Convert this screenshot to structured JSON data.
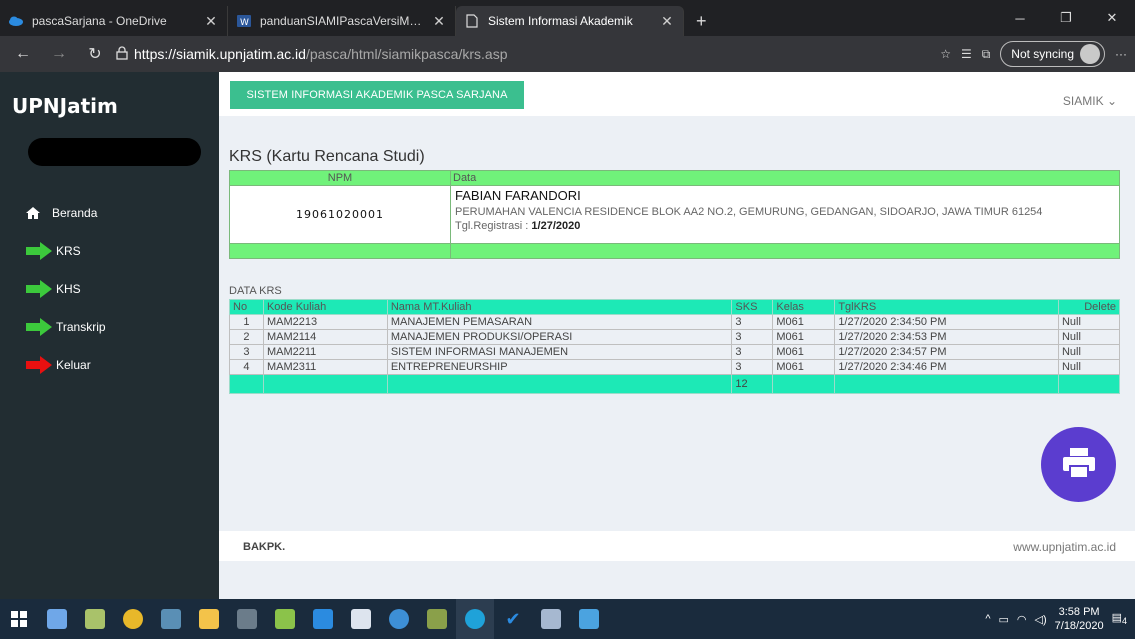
{
  "browser": {
    "tabs": [
      {
        "title": "pascaSarjana - OneDrive",
        "icon": "onedrive-icon",
        "active": false
      },
      {
        "title": "panduanSIAMIPascaVersiMahasi",
        "icon": "word-doc-icon",
        "active": false
      },
      {
        "title": "Sistem Informasi Akademik",
        "icon": "page-icon",
        "active": true
      }
    ],
    "url_host": "https://siamik.upnjatim.ac.id",
    "url_path": "/pasca/html/siamikpasca/krs.asp",
    "sync_label": "Not syncing"
  },
  "sidebar": {
    "brand": "UPNJatim",
    "items": [
      {
        "label": "Beranda",
        "icon": "home-icon"
      },
      {
        "label": "KRS",
        "icon": "green-arrow-icon"
      },
      {
        "label": "KHS",
        "icon": "green-arrow-icon"
      },
      {
        "label": "Transkrip",
        "icon": "green-arrow-icon"
      },
      {
        "label": "Keluar",
        "icon": "red-arrow-icon"
      }
    ]
  },
  "header": {
    "system_button": "SISTEM INFORMASI AKADEMIK PASCA SARJANA",
    "user_menu": "SIAMIK"
  },
  "krs": {
    "title": "KRS (Kartu Rencana Studi)",
    "npm_label": "NPM",
    "data_label": "Data",
    "npm": "19061020001",
    "nama": "FABIAN FARANDORI",
    "alamat": "PERUMAHAN VALENCIA RESIDENCE BLOK AA2 NO.2, GEMURUNG, GEDANGAN, SIDOARJO, JAWA TIMUR 61254",
    "tgl_label": "Tgl.Registrasi : ",
    "tgl_value": "1/27/2020"
  },
  "data_krs": {
    "label": "DATA KRS",
    "headers": [
      "No",
      "Kode Kuliah",
      "Nama MT.Kuliah",
      "SKS",
      "Kelas",
      "TglKRS",
      "Delete"
    ],
    "rows": [
      [
        "1",
        "MAM2213",
        "MANAJEMEN PEMASARAN",
        "3",
        "M061",
        "1/27/2020 2:34:50 PM",
        "Null"
      ],
      [
        "2",
        "MAM2114",
        "MANAJEMEN PRODUKSI/OPERASI",
        "3",
        "M061",
        "1/27/2020 2:34:53 PM",
        "Null"
      ],
      [
        "3",
        "MAM2211",
        "SISTEM INFORMASI MANAJEMEN",
        "3",
        "M061",
        "1/27/2020 2:34:57 PM",
        "Null"
      ],
      [
        "4",
        "MAM2311",
        "ENTREPRENEURSHIP",
        "3",
        "M061",
        "1/27/2020 2:34:46 PM",
        "Null"
      ]
    ],
    "total_sks": "12"
  },
  "footer": {
    "left": "BAKPK.",
    "right": "www.upnjatim.ac.id"
  },
  "taskbar": {
    "time": "3:58 PM",
    "date": "7/18/2020",
    "notifications": "4"
  },
  "colors": {
    "sidebar_bg": "#222d32",
    "green_header": "#70f27a",
    "teal_header": "#1de9b6",
    "system_button": "#3bbf8f",
    "print_button": "#5b3dcf"
  }
}
